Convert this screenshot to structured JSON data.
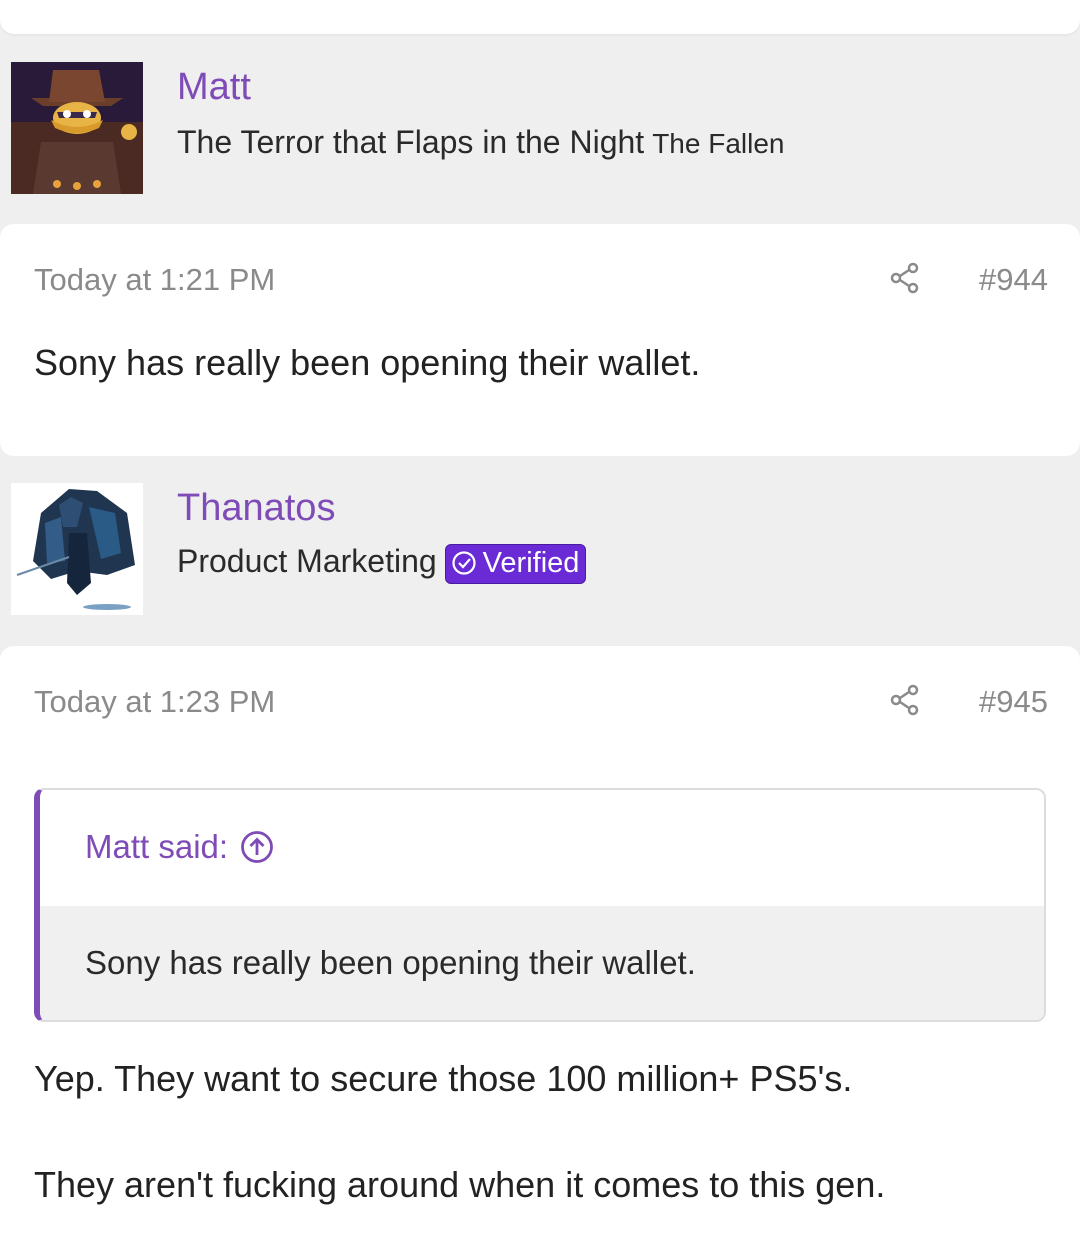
{
  "posts": [
    {
      "user": {
        "name": "Matt",
        "title": "The Terror that Flaps in the Night",
        "extra": "The Fallen"
      },
      "time": "Today at 1:21 PM",
      "number": "#944",
      "body": "Sony has really been opening their wallet."
    },
    {
      "user": {
        "name": "Thanatos",
        "title": "Product Marketing",
        "badge": "Verified"
      },
      "time": "Today at 1:23 PM",
      "number": "#945",
      "quote": {
        "attribution": "Matt said:",
        "text": "Sony has really been opening their wallet."
      },
      "body_lines": [
        "Yep. They want to secure those 100 million+ PS5's.",
        "They aren't fucking around when it comes to this gen."
      ]
    }
  ],
  "icons": {
    "share": "share-icon",
    "quote_jump": "arrow-up-circle-icon",
    "verified": "check-circle-icon"
  },
  "colors": {
    "accent": "#7e4bb7",
    "badge": "#6a2ad6"
  }
}
